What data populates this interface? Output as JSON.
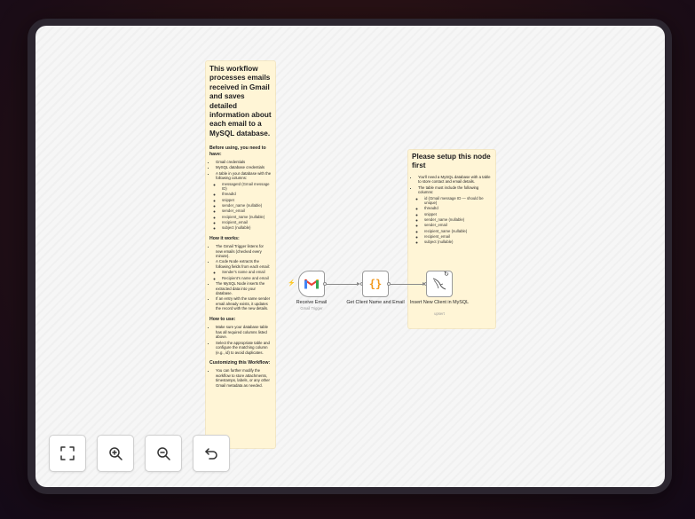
{
  "sticky_notes": {
    "workflow_info": {
      "title": "This workflow processes emails received in Gmail and saves detailed information about each email to a MySQL database.",
      "before_heading": "Before using, you need to have:",
      "before_items": [
        "Gmail credentials",
        "MySQL database credentials",
        "A table in your database with the following columns:"
      ],
      "columns": [
        "messageId (Gmail message ID)",
        "threadId",
        "snippet",
        "sender_name (nullable)",
        "sender_email",
        "recipient_name (nullable)",
        "recipient_email",
        "subject (nullable)"
      ],
      "how_works_heading": "How it works:",
      "how_works_1": "The Gmail Trigger listens for new emails (checked every minute).",
      "how_works_2": "A Code Node extracts the following fields from each email:",
      "extracted": [
        "Sender's name and email",
        "Recipient's name and email"
      ],
      "how_works_3": "The MySQL Node inserts the extracted data into your database.",
      "how_works_4": "If an entry with the same sender email already exists, it updates the record with the new details.",
      "how_use_heading": "How to use:",
      "how_use_1": "Make sure your database table has all required columns listed above.",
      "how_use_2": "Select the appropriate table and configure the matching column (e.g., id) to avoid duplicates.",
      "customize_heading": "Customizing this Workflow:",
      "customize_1": "You can further modify the workflow to store attachments, timestamps, labels, or any other Gmail metadata as needed."
    },
    "setup_note": {
      "title": "Please setup this node first",
      "item_1": "You'll need a MySQL database with a table to store contact and email details.",
      "item_2": "The table must include the following columns:",
      "columns": [
        "id (Gmail message ID — should be unique)",
        "threadId",
        "snippet",
        "sender_name (nullable)",
        "sender_email",
        "recipient_name (nullable)",
        "recipient_email",
        "subject (nullable)"
      ]
    }
  },
  "nodes": [
    {
      "label": "Receive Email",
      "subtitle": "Gmail Trigger",
      "icon": "gmail-icon"
    },
    {
      "label": "Get Client Name and Email",
      "subtitle": "",
      "icon": "code-braces-icon"
    },
    {
      "label": "Insert New Client in MySQL",
      "subtitle": "upsert",
      "icon": "mysql-dolphin-icon"
    }
  ],
  "controls": [
    "fit-view-icon",
    "zoom-in-icon",
    "zoom-out-icon",
    "reset-zoom-icon"
  ],
  "colors": {
    "sticky": "#fff5d6",
    "trigger_bolt": "#ff6d5a",
    "code_icon": "#f29a1f",
    "gmail_red": "#ea4335"
  }
}
